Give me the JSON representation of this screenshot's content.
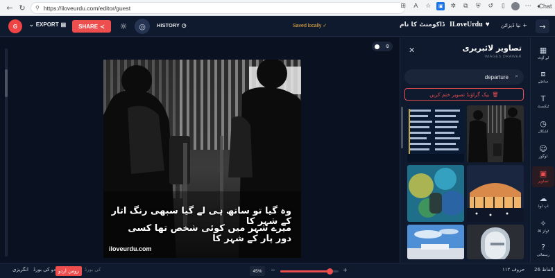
{
  "browser": {
    "url": "https://iloveurdu.com/editor/guest",
    "chat_label": "Chat"
  },
  "header": {
    "avatar_initial": "G",
    "export_label": "EXPORT",
    "share_label": "SHARE",
    "history_label": "HISTORY",
    "saved_status": "Saved locally",
    "document_name": "ڈاکومنٹ کا نام",
    "brand": "ILoveUrdu",
    "new_design_label": "نیا ڈیزائن"
  },
  "poster": {
    "line1": "وہ گیا تو ساتھ ہی لے گیا سبھی رنگ اتار کے شہر کا",
    "line2": "میرے شہر میں کوئی شخص تھا کسی دور پار کے شہر کا",
    "site": "iloveurdu.com"
  },
  "panel": {
    "title": "تصاویر لائبریری",
    "subtitle": "IMAGES DRAWER",
    "search_value": "departure",
    "remove_bg_label": "بیک گراؤنڈ تصویر ختم کریں"
  },
  "rail": [
    {
      "label": "لے آؤٹ",
      "icon": "layout-icon"
    },
    {
      "label": "سانچے",
      "icon": "templates-icon"
    },
    {
      "label": "ٹیکسٹ",
      "icon": "text-icon"
    },
    {
      "label": "اشکال",
      "icon": "shapes-icon"
    },
    {
      "label": "لوگوز",
      "icon": "logos-icon"
    },
    {
      "label": "تصاویر",
      "icon": "images-icon"
    },
    {
      "label": "اپ لوڈ",
      "icon": "upload-icon"
    },
    {
      "label": "AI ٹولز",
      "icon": "ai-tools-icon"
    },
    {
      "label": "رہنمائی",
      "icon": "help-icon"
    }
  ],
  "bottom": {
    "english_label": "انگریزی",
    "urdu_word_label": "اردو کی بورڈ",
    "roman_urdu_label": "رومن اردو",
    "typing_label": "کی بورڈ",
    "zoom_percent": "45%",
    "zoom_level": 0.85,
    "char_count": "۱۱۲ حروف",
    "word_count": "26 الفاظ"
  },
  "colors": {
    "accent": "#ef4e4e",
    "saved": "#f5b642",
    "background": "#0a1120"
  }
}
